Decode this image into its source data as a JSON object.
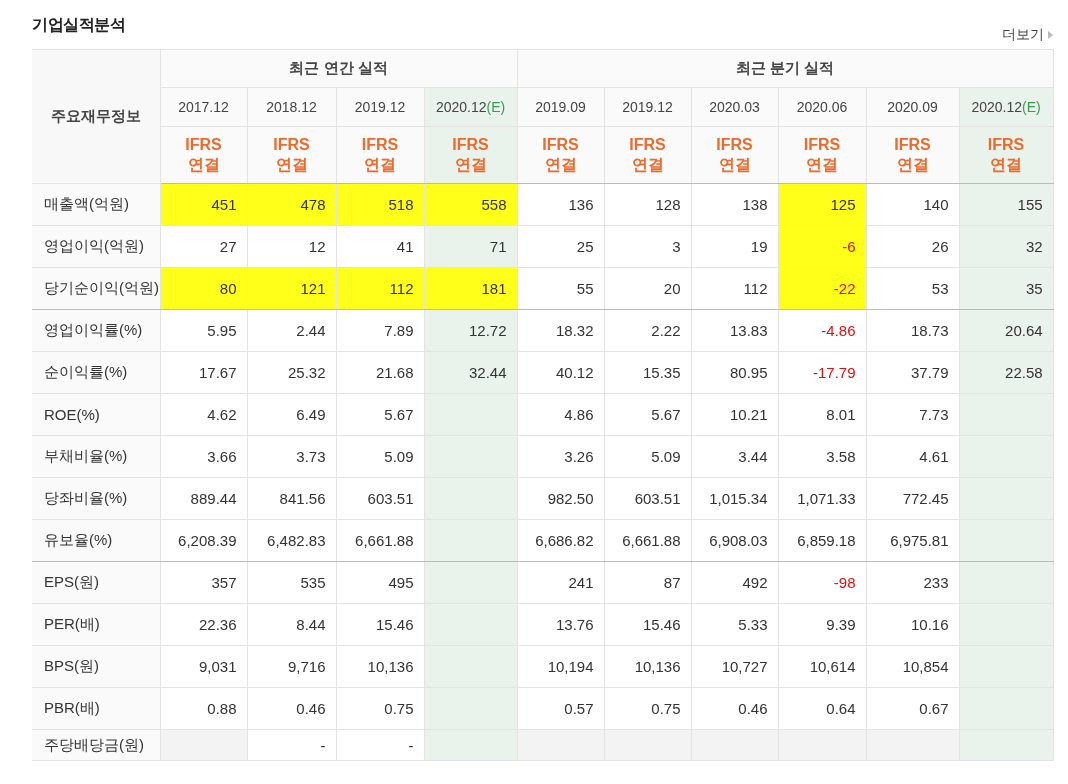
{
  "title": "기업실적분석",
  "more_link": "더보기",
  "header": {
    "row_label": "주요재무정보",
    "groups": [
      {
        "label": "최근 연간 실적",
        "periods": [
          {
            "date": "2017.12",
            "estimate": false,
            "basis": "IFRS",
            "scope": "연결"
          },
          {
            "date": "2018.12",
            "estimate": false,
            "basis": "IFRS",
            "scope": "연결"
          },
          {
            "date": "2019.12",
            "estimate": false,
            "basis": "IFRS",
            "scope": "연결"
          },
          {
            "date": "2020.12",
            "mark": "(E)",
            "estimate": true,
            "basis": "IFRS",
            "scope": "연결"
          }
        ]
      },
      {
        "label": "최근 분기 실적",
        "periods": [
          {
            "date": "2019.09",
            "estimate": false,
            "basis": "IFRS",
            "scope": "연결"
          },
          {
            "date": "2019.12",
            "estimate": false,
            "basis": "IFRS",
            "scope": "연결"
          },
          {
            "date": "2020.03",
            "estimate": false,
            "basis": "IFRS",
            "scope": "연결"
          },
          {
            "date": "2020.06",
            "estimate": false,
            "basis": "IFRS",
            "scope": "연결"
          },
          {
            "date": "2020.09",
            "estimate": false,
            "basis": "IFRS",
            "scope": "연결"
          },
          {
            "date": "2020.12",
            "mark": "(E)",
            "estimate": true,
            "basis": "IFRS",
            "scope": "연결"
          }
        ]
      }
    ]
  },
  "rows": [
    {
      "label": "매출액(억원)",
      "section_end": false,
      "cells": [
        {
          "text": "451",
          "highlighted": true,
          "negative": false
        },
        {
          "text": "478",
          "highlighted": true,
          "negative": false
        },
        {
          "text": "518",
          "highlighted": true,
          "negative": false
        },
        {
          "text": "558",
          "highlighted": true,
          "negative": false
        },
        {
          "text": "136",
          "highlighted": false,
          "negative": false
        },
        {
          "text": "128",
          "highlighted": false,
          "negative": false
        },
        {
          "text": "138",
          "highlighted": false,
          "negative": false
        },
        {
          "text": "125",
          "highlighted": true,
          "negative": false
        },
        {
          "text": "140",
          "highlighted": false,
          "negative": false
        },
        {
          "text": "155",
          "highlighted": false,
          "negative": false
        }
      ]
    },
    {
      "label": "영업이익(억원)",
      "section_end": false,
      "cells": [
        {
          "text": "27",
          "highlighted": false,
          "negative": false
        },
        {
          "text": "12",
          "highlighted": false,
          "negative": false
        },
        {
          "text": "41",
          "highlighted": false,
          "negative": false
        },
        {
          "text": "71",
          "highlighted": false,
          "negative": false
        },
        {
          "text": "25",
          "highlighted": false,
          "negative": false
        },
        {
          "text": "3",
          "highlighted": false,
          "negative": false
        },
        {
          "text": "19",
          "highlighted": false,
          "negative": false
        },
        {
          "text": "-6",
          "highlighted": true,
          "negative": true
        },
        {
          "text": "26",
          "highlighted": false,
          "negative": false
        },
        {
          "text": "32",
          "highlighted": false,
          "negative": false
        }
      ]
    },
    {
      "label": "당기순이익(억원)",
      "section_end": true,
      "cells": [
        {
          "text": "80",
          "highlighted": true,
          "negative": false
        },
        {
          "text": "121",
          "highlighted": true,
          "negative": false
        },
        {
          "text": "112",
          "highlighted": true,
          "negative": false
        },
        {
          "text": "181",
          "highlighted": true,
          "negative": false
        },
        {
          "text": "55",
          "highlighted": false,
          "negative": false
        },
        {
          "text": "20",
          "highlighted": false,
          "negative": false
        },
        {
          "text": "112",
          "highlighted": false,
          "negative": false
        },
        {
          "text": "-22",
          "highlighted": true,
          "negative": true
        },
        {
          "text": "53",
          "highlighted": false,
          "negative": false
        },
        {
          "text": "35",
          "highlighted": false,
          "negative": false
        }
      ]
    },
    {
      "label": "영업이익률(%)",
      "section_end": false,
      "cells": [
        {
          "text": "5.95",
          "negative": false
        },
        {
          "text": "2.44",
          "negative": false
        },
        {
          "text": "7.89",
          "negative": false
        },
        {
          "text": "12.72",
          "negative": false
        },
        {
          "text": "18.32",
          "negative": false
        },
        {
          "text": "2.22",
          "negative": false
        },
        {
          "text": "13.83",
          "negative": false
        },
        {
          "text": "-4.86",
          "negative": true
        },
        {
          "text": "18.73",
          "negative": false
        },
        {
          "text": "20.64",
          "negative": false
        }
      ]
    },
    {
      "label": "순이익률(%)",
      "section_end": false,
      "cells": [
        {
          "text": "17.67",
          "negative": false
        },
        {
          "text": "25.32",
          "negative": false
        },
        {
          "text": "21.68",
          "negative": false
        },
        {
          "text": "32.44",
          "negative": false
        },
        {
          "text": "40.12",
          "negative": false
        },
        {
          "text": "15.35",
          "negative": false
        },
        {
          "text": "80.95",
          "negative": false
        },
        {
          "text": "-17.79",
          "negative": true
        },
        {
          "text": "37.79",
          "negative": false
        },
        {
          "text": "22.58",
          "negative": false
        }
      ]
    },
    {
      "label": "ROE(%)",
      "section_end": false,
      "cells": [
        {
          "text": "4.62"
        },
        {
          "text": "6.49"
        },
        {
          "text": "5.67"
        },
        {},
        {
          "text": "4.86"
        },
        {
          "text": "5.67"
        },
        {
          "text": "10.21"
        },
        {
          "text": "8.01"
        },
        {
          "text": "7.73"
        },
        {}
      ]
    },
    {
      "label": "부채비율(%)",
      "section_end": false,
      "cells": [
        {
          "text": "3.66"
        },
        {
          "text": "3.73"
        },
        {
          "text": "5.09"
        },
        {},
        {
          "text": "3.26"
        },
        {
          "text": "5.09"
        },
        {
          "text": "3.44"
        },
        {
          "text": "3.58"
        },
        {
          "text": "4.61"
        },
        {}
      ]
    },
    {
      "label": "당좌비율(%)",
      "section_end": false,
      "cells": [
        {
          "text": "889.44"
        },
        {
          "text": "841.56"
        },
        {
          "text": "603.51"
        },
        {},
        {
          "text": "982.50"
        },
        {
          "text": "603.51"
        },
        {
          "text": "1,015.34"
        },
        {
          "text": "1,071.33"
        },
        {
          "text": "772.45"
        },
        {}
      ]
    },
    {
      "label": "유보율(%)",
      "section_end": true,
      "cells": [
        {
          "text": "6,208.39"
        },
        {
          "text": "6,482.83"
        },
        {
          "text": "6,661.88"
        },
        {},
        {
          "text": "6,686.82"
        },
        {
          "text": "6,661.88"
        },
        {
          "text": "6,908.03"
        },
        {
          "text": "6,859.18"
        },
        {
          "text": "6,975.81"
        },
        {}
      ]
    },
    {
      "label": "EPS(원)",
      "section_end": false,
      "cells": [
        {
          "text": "357",
          "negative": false
        },
        {
          "text": "535",
          "negative": false
        },
        {
          "text": "495",
          "negative": false
        },
        {},
        {
          "text": "241",
          "negative": false
        },
        {
          "text": "87",
          "negative": false
        },
        {
          "text": "492",
          "negative": false
        },
        {
          "text": "-98",
          "negative": true
        },
        {
          "text": "233",
          "negative": false
        },
        {}
      ]
    },
    {
      "label": "PER(배)",
      "section_end": false,
      "cells": [
        {
          "text": "22.36"
        },
        {
          "text": "8.44"
        },
        {
          "text": "15.46"
        },
        {},
        {
          "text": "13.76"
        },
        {
          "text": "15.46"
        },
        {
          "text": "5.33"
        },
        {
          "text": "9.39"
        },
        {
          "text": "10.16"
        },
        {}
      ]
    },
    {
      "label": "BPS(원)",
      "section_end": false,
      "cells": [
        {
          "text": "9,031"
        },
        {
          "text": "9,716"
        },
        {
          "text": "10,136"
        },
        {},
        {
          "text": "10,194"
        },
        {
          "text": "10,136"
        },
        {
          "text": "10,727"
        },
        {
          "text": "10,614"
        },
        {
          "text": "10,854"
        },
        {}
      ]
    },
    {
      "label": "PBR(배)",
      "section_end": false,
      "cells": [
        {
          "text": "0.88"
        },
        {
          "text": "0.46"
        },
        {
          "text": "0.75"
        },
        {},
        {
          "text": "0.57"
        },
        {
          "text": "0.75"
        },
        {
          "text": "0.46"
        },
        {
          "text": "0.64"
        },
        {
          "text": "0.67"
        },
        {}
      ]
    },
    {
      "label": "주당배당금(원)",
      "section_end": false,
      "cells": [
        {
          "shaded": true
        },
        {
          "text": "-",
          "shaded": false
        },
        {
          "text": "-",
          "shaded": false
        },
        {},
        {
          "shaded": true
        },
        {
          "shaded": true
        },
        {
          "shaded": true
        },
        {
          "shaded": true
        },
        {
          "shaded": true
        },
        {}
      ]
    }
  ]
}
